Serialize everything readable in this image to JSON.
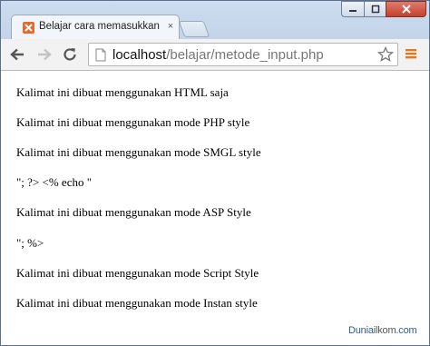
{
  "window": {
    "controls": [
      "minimize",
      "maximize",
      "close"
    ]
  },
  "tab": {
    "title": "Belajar cara memasukkan",
    "close_glyph": "×",
    "favicon": "xampp-icon"
  },
  "toolbar": {
    "back_icon": "back-arrow-icon",
    "forward_icon": "forward-arrow-icon",
    "reload_icon": "reload-icon",
    "url_host": "localhost",
    "url_path": "/belajar/metode_input.php",
    "bookmark_icon": "star-icon",
    "menu_icon": "hamburger-menu-icon"
  },
  "page": {
    "lines": [
      "Kalimat ini dibuat menggunakan HTML saja",
      "Kalimat ini dibuat menggunakan mode PHP style",
      "Kalimat ini dibuat menggunakan mode SMGL style",
      "\"; ?> <% echo \"",
      "Kalimat ini dibuat menggunakan mode ASP Style",
      "\"; %>",
      "Kalimat ini dibuat menggunakan mode Script Style",
      "Kalimat ini dibuat menggunakan mode Instan style"
    ],
    "watermark_part1": "Dunia",
    "watermark_part2": "ilkom",
    "watermark_part3": ".com"
  },
  "colors": {
    "favicon": "#e8692b",
    "menu_accent": "#e07a1f",
    "watermark": "#2e5d8f"
  }
}
